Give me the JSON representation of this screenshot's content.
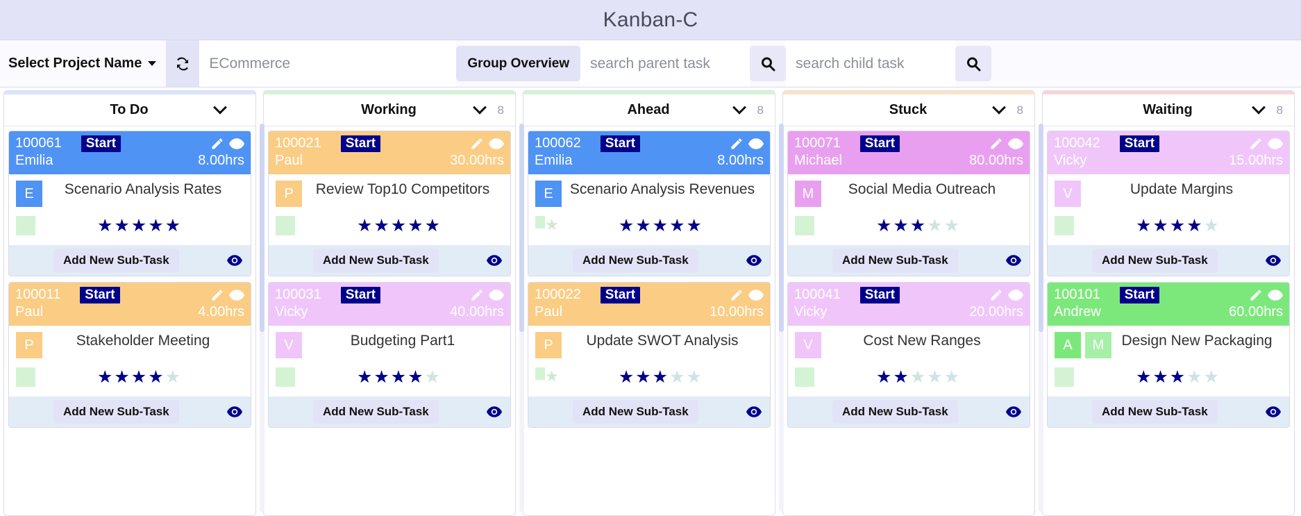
{
  "app": {
    "title": "Kanban-C"
  },
  "toolbar": {
    "project_select_label": "Select Project Name",
    "refresh_icon": "refresh-icon",
    "project_value": "ECommerce",
    "group_overview_label": "Group Overview",
    "parent_search_placeholder": "search parent task",
    "child_search_placeholder": "search child task",
    "search_icon": "search-icon"
  },
  "colors": {
    "title_bar": "#e3e3f7",
    "start_badge": "#00008b",
    "star_filled": "#00008b",
    "star_empty": "#cfe3e3",
    "card_blue": "#4f93f5",
    "card_orange": "#fbcc84",
    "card_pink": "#e99ff0",
    "card_plum": "#f0c6fa",
    "card_green": "#7ce87c",
    "footer": "#e2ecf6",
    "swatch_green": "#d4f3d4"
  },
  "columns": [
    {
      "name": "To Do",
      "count": "",
      "accent": "#dbe4fb",
      "cards": [
        {
          "id": "100061",
          "start": "Start",
          "assignee": "Emilia",
          "hours": "8.00hrs",
          "title": "Scenario Analysis Rates",
          "avatars": [
            "E"
          ],
          "rating": 5,
          "header_color": "#4f93f5",
          "avatar_color": "#4f93f5",
          "id_color": "#ffffff",
          "swatch": "big",
          "add_sub_task": "Add New Sub-Task"
        },
        {
          "id": "100011",
          "start": "Start",
          "assignee": "Paul",
          "hours": "4.00hrs",
          "title": "Stakeholder Meeting",
          "avatars": [
            "P"
          ],
          "rating": 4,
          "header_color": "#fbcc84",
          "avatar_color": "#fbcc84",
          "id_color": "#ffffff",
          "swatch": "big",
          "add_sub_task": "Add New Sub-Task"
        }
      ]
    },
    {
      "name": "Working",
      "count": "8",
      "accent": "#d4f3d4",
      "cards": [
        {
          "id": "100021",
          "start": "Start",
          "assignee": "Paul",
          "hours": "30.00hrs",
          "title": "Review Top10 Competitors",
          "avatars": [
            "P"
          ],
          "rating": 5,
          "header_color": "#fbcc84",
          "avatar_color": "#fbcc84",
          "id_color": "#ffffff",
          "swatch": "big",
          "add_sub_task": "Add New Sub-Task"
        },
        {
          "id": "100031",
          "start": "Start",
          "assignee": "Vicky",
          "hours": "40.00hrs",
          "title": "Budgeting Part1",
          "avatars": [
            "V"
          ],
          "rating": 4,
          "header_color": "#f0c6fa",
          "avatar_color": "#f0c6fa",
          "id_color": "#ffffff",
          "swatch": "big",
          "add_sub_task": "Add New Sub-Task"
        }
      ]
    },
    {
      "name": "Ahead",
      "count": "8",
      "accent": "#d4f3d4",
      "cards": [
        {
          "id": "100062",
          "start": "Start",
          "assignee": "Emilia",
          "hours": "8.00hrs",
          "title": "Scenario Analysis Revenues",
          "avatars": [
            "E"
          ],
          "rating": 5,
          "header_color": "#4f93f5",
          "avatar_color": "#4f93f5",
          "id_color": "#ffffff",
          "swatch": "small-star",
          "add_sub_task": "Add New Sub-Task"
        },
        {
          "id": "100022",
          "start": "Start",
          "assignee": "Paul",
          "hours": "10.00hrs",
          "title": "Update SWOT Analysis",
          "avatars": [
            "P"
          ],
          "rating": 3,
          "header_color": "#fbcc84",
          "avatar_color": "#fbcc84",
          "id_color": "#ffffff",
          "swatch": "small-star",
          "add_sub_task": "Add New Sub-Task"
        }
      ]
    },
    {
      "name": "Stuck",
      "count": "8",
      "accent": "#fbe3c8",
      "cards": [
        {
          "id": "100071",
          "start": "Start",
          "assignee": "Michael",
          "hours": "80.00hrs",
          "title": "Social Media Outreach",
          "avatars": [
            "M"
          ],
          "rating": 3,
          "header_color": "#e99ff0",
          "avatar_color": "#e99ff0",
          "id_color": "#ffffff",
          "swatch": "big",
          "add_sub_task": "Add New Sub-Task"
        },
        {
          "id": "100041",
          "start": "Start",
          "assignee": "Vicky",
          "hours": "20.00hrs",
          "title": "Cost New Ranges",
          "avatars": [
            "V"
          ],
          "rating": 2,
          "header_color": "#f0c6fa",
          "avatar_color": "#f0c6fa",
          "id_color": "#ffffff",
          "swatch": "big",
          "add_sub_task": "Add New Sub-Task"
        }
      ]
    },
    {
      "name": "Waiting",
      "count": "8",
      "accent": "#fbd6d6",
      "cards": [
        {
          "id": "100042",
          "start": "Start",
          "assignee": "Vicky",
          "hours": "15.00hrs",
          "title": "Update Margins",
          "avatars": [
            "V"
          ],
          "rating": 4,
          "header_color": "#f0c6fa",
          "avatar_color": "#f0c6fa",
          "id_color": "#ffffff",
          "swatch": "big",
          "add_sub_task": "Add New Sub-Task"
        },
        {
          "id": "100101",
          "start": "Start",
          "assignee": "Andrew",
          "hours": "60.00hrs",
          "title": "Design New Packaging",
          "avatars": [
            "A",
            "M"
          ],
          "rating": 3,
          "header_color": "#7ce87c",
          "avatar_color": "#7ce87c",
          "avatar_color2": "#a6efa6",
          "id_color": "#ffffff",
          "swatch": "big",
          "add_sub_task": "Add New Sub-Task"
        }
      ]
    }
  ]
}
